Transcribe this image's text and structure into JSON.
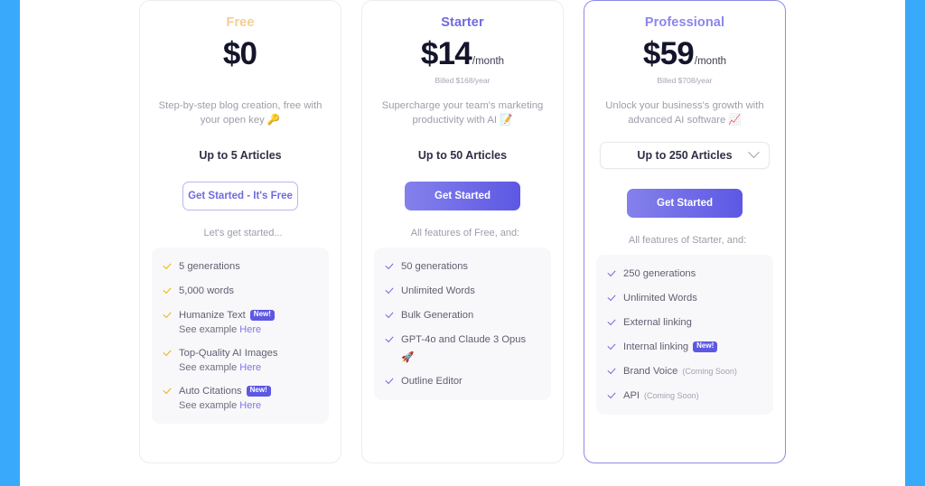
{
  "theme": {
    "side_bar_color": "#38a9fb",
    "accent_purple": "#6f6be0",
    "accent_amber": "#eab308",
    "badge_color": "#5d58e4",
    "page_background": "#ffffff"
  },
  "plans": [
    {
      "name": "Free",
      "price": "$0",
      "per": "",
      "billed": "",
      "description": "Step-by-step blog creation, free with your open key",
      "description_emoji": "🔑",
      "articles_label": "Up to 5 Articles",
      "has_dropdown": false,
      "cta_label": "Get Started - It's Free",
      "cta_style": "outline",
      "sub_note": "Let's get started...",
      "check_color": "amber",
      "features": [
        {
          "label": "5 generations"
        },
        {
          "label": "5,000 words"
        },
        {
          "label": "Humanize Text",
          "badge": "New!",
          "example_prefix": "See example",
          "example_link": "Here"
        },
        {
          "label": "Top-Quality AI Images",
          "example_prefix": "See example",
          "example_link": "Here"
        },
        {
          "label": "Auto Citations",
          "badge": "New!",
          "example_prefix": "See example",
          "example_link": "Here"
        }
      ]
    },
    {
      "name": "Starter",
      "price": "$14",
      "per": "/month",
      "billed": "Billed $168/year",
      "description": "Supercharge your team's marketing productivity with AI",
      "description_emoji": "📝",
      "articles_label": "Up to 50 Articles",
      "has_dropdown": false,
      "cta_label": "Get Started",
      "cta_style": "filled",
      "sub_note": "All features of Free, and:",
      "check_color": "purple",
      "features": [
        {
          "label": "50 generations"
        },
        {
          "label": "Unlimited Words"
        },
        {
          "label": "Bulk Generation"
        },
        {
          "label": "GPT-4o and Claude 3 Opus",
          "emoji": "🚀"
        },
        {
          "label": "Outline Editor"
        }
      ]
    },
    {
      "name": "Professional",
      "price": "$59",
      "per": "/month",
      "billed": "Billed $708/year",
      "description": "Unlock your business's growth with advanced AI software",
      "description_emoji": "📈",
      "articles_label": "Up to 250 Articles",
      "has_dropdown": true,
      "dropdown_icon": "chevron-down-icon",
      "cta_label": "Get Started",
      "cta_style": "filled",
      "sub_note": "All features of Starter, and:",
      "check_color": "purple",
      "highlighted": true,
      "features": [
        {
          "label": "250 generations"
        },
        {
          "label": "Unlimited Words"
        },
        {
          "label": "External linking"
        },
        {
          "label": "Internal linking",
          "badge": "New!"
        },
        {
          "label": "Brand Voice",
          "soon": "(Coming Soon)"
        },
        {
          "label": "API",
          "soon": "(Coming Soon)"
        }
      ]
    }
  ]
}
